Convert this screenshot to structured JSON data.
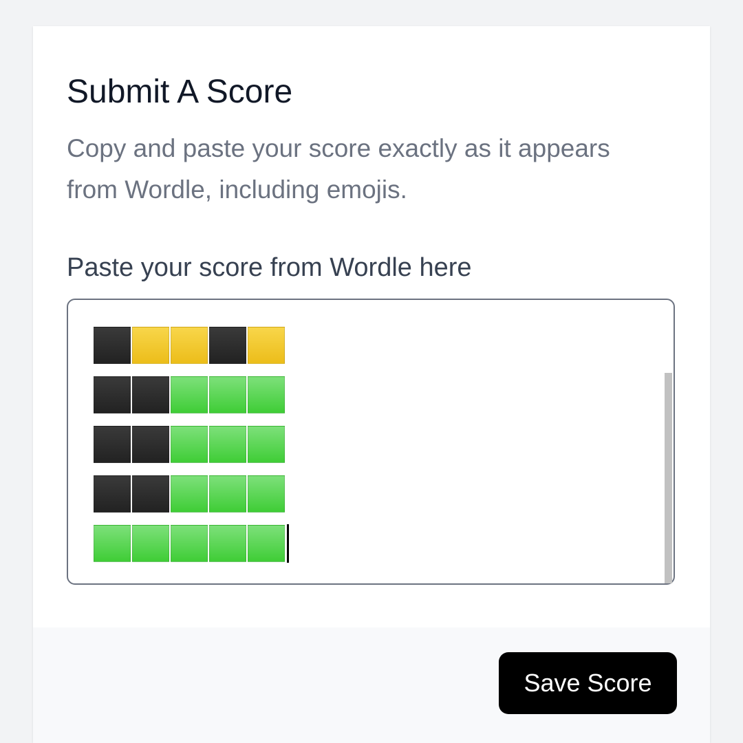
{
  "form": {
    "title": "Submit A Score",
    "description": "Copy and paste your score exactly as it appears from Wordle, including emojis.",
    "field_label": "Paste your score from Wordle here",
    "score_grid": [
      [
        "black",
        "yellow",
        "yellow",
        "black",
        "yellow"
      ],
      [
        "black",
        "black",
        "green",
        "green",
        "green"
      ],
      [
        "black",
        "black",
        "green",
        "green",
        "green"
      ],
      [
        "black",
        "black",
        "green",
        "green",
        "green"
      ],
      [
        "green",
        "green",
        "green",
        "green",
        "green"
      ]
    ],
    "save_label": "Save Score"
  },
  "colors": {
    "black_square": "#2b2b2b",
    "yellow_square": "#f2c824",
    "green_square": "#5cd64f",
    "button_bg": "#000000",
    "title_text": "#111827",
    "description_text": "#6b7280"
  }
}
